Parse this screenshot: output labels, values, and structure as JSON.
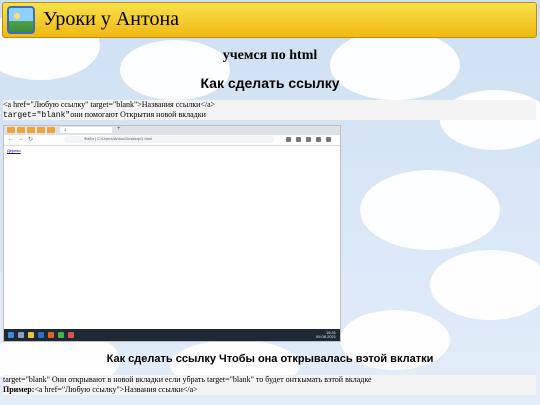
{
  "site": {
    "title": "Уроки у Антона",
    "logo_icon": "picture-icon"
  },
  "headings": {
    "top": "учемся по html",
    "main": "Как сделать ссылку",
    "sub": "Как сделать ссылку Чтобы она открывалась вэтой вклатки"
  },
  "code1": {
    "line1": "<a href=\"Любую ссылку\" target=\"blank\">Названия ссылки</a>",
    "line2_code": "target=\"blank\"",
    "line2_text": "они помогают Открытия новой вкладки"
  },
  "screenshot": {
    "tab_label": "1",
    "new_tab": "+",
    "url": "Файл | C:/Users/Anton/Desktop/1.html",
    "link_text": "Дерево",
    "taskbar_time": "16:31",
    "taskbar_date": "09.08.2021",
    "tray_text": "^ ☁ 🔈 РУС"
  },
  "code2": {
    "line1": "target=\"blank\" Они открывают в новой вкладки если убрать target=\"blank\" то будет онткымать вэтой вкладке",
    "example_label": "Пример:",
    "example_code": "<a href=\"Любую ссылку\">Названия ссылки</a>"
  },
  "colors": {
    "header_top": "#f8e24a",
    "header_bottom": "#f0b913",
    "sky": "#dbe8f6",
    "code_bg": "#f4f4f4"
  }
}
